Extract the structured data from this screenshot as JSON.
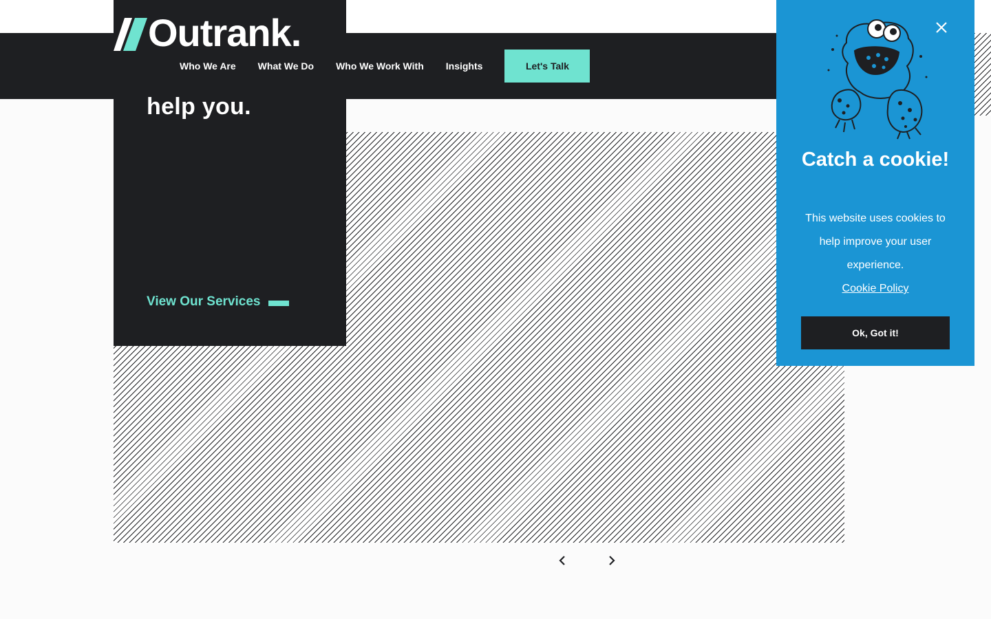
{
  "header": {
    "logo_text": "Outrank.",
    "nav": [
      {
        "label": "Who We Are"
      },
      {
        "label": "What We Do"
      },
      {
        "label": "Who We Work With"
      },
      {
        "label": "Insights"
      }
    ],
    "cta_label": "Let's Talk"
  },
  "hero": {
    "text": "help you.",
    "services_link": "View Our Services"
  },
  "carousel": {
    "prev_icon": "chevron-left-icon",
    "next_icon": "chevron-right-icon"
  },
  "cookie_banner": {
    "title": "Catch a cookie!",
    "message": "This website uses cookies to help improve your user experience.",
    "policy_link": "Cookie Policy",
    "accept_label": "Ok, Got it!",
    "close_icon": "close-icon",
    "illustration": "cookie-monster-icon"
  },
  "colors": {
    "dark": "#1e1f22",
    "accent": "#6fe3d0",
    "cookie_blue": "#1b95d4",
    "background": "#fbfbfb"
  }
}
